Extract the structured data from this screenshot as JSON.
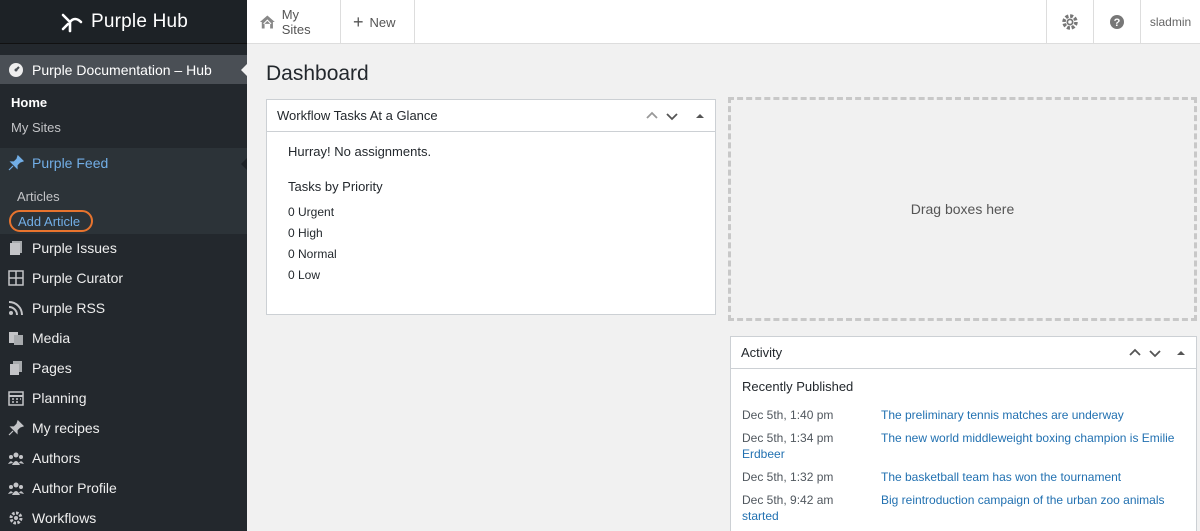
{
  "brand": {
    "name": "Purple Hub"
  },
  "sidebar": {
    "site_label": "Purple Documentation – Hub",
    "home": "Home",
    "my_sites": "My Sites",
    "feed": {
      "label": "Purple Feed",
      "articles": "Articles",
      "add_article": "Add Article"
    },
    "items": [
      {
        "label": "Purple Issues",
        "icon": "copy-icon"
      },
      {
        "label": "Purple Curator",
        "icon": "grid-icon"
      },
      {
        "label": "Purple RSS",
        "icon": "rss-icon"
      },
      {
        "label": "Media",
        "icon": "media-icon"
      },
      {
        "label": "Pages",
        "icon": "pages-icon"
      },
      {
        "label": "Planning",
        "icon": "calendar-icon"
      },
      {
        "label": "My recipes",
        "icon": "pin-icon"
      },
      {
        "label": "Authors",
        "icon": "users-icon"
      },
      {
        "label": "Author Profile",
        "icon": "users-icon"
      },
      {
        "label": "Workflows",
        "icon": "gear-icon"
      }
    ]
  },
  "topbar": {
    "my_sites": "My Sites",
    "new": "New",
    "user": "sladmin"
  },
  "main": {
    "title": "Dashboard",
    "workflow": {
      "title": "Workflow Tasks At a Glance",
      "empty": "Hurray! No assignments.",
      "priority_heading": "Tasks by Priority",
      "priorities": [
        "0 Urgent",
        "0 High",
        "0 Normal",
        "0 Low"
      ]
    },
    "dropzone": "Drag boxes here",
    "activity": {
      "title": "Activity",
      "heading": "Recently Published",
      "items": [
        {
          "date": "Dec 5th, 1:40 pm",
          "title": "The preliminary tennis matches are underway",
          "cont": ""
        },
        {
          "date": "Dec 5th, 1:34 pm",
          "title": "The new world middleweight boxing champion is Emilie",
          "cont": "Erdbeer"
        },
        {
          "date": "Dec 5th, 1:32 pm",
          "title": "The basketball team has won the tournament",
          "cont": ""
        },
        {
          "date": "Dec 5th, 9:42 am",
          "title": "Big reintroduction campaign of the urban zoo animals",
          "cont": "started"
        }
      ]
    }
  }
}
